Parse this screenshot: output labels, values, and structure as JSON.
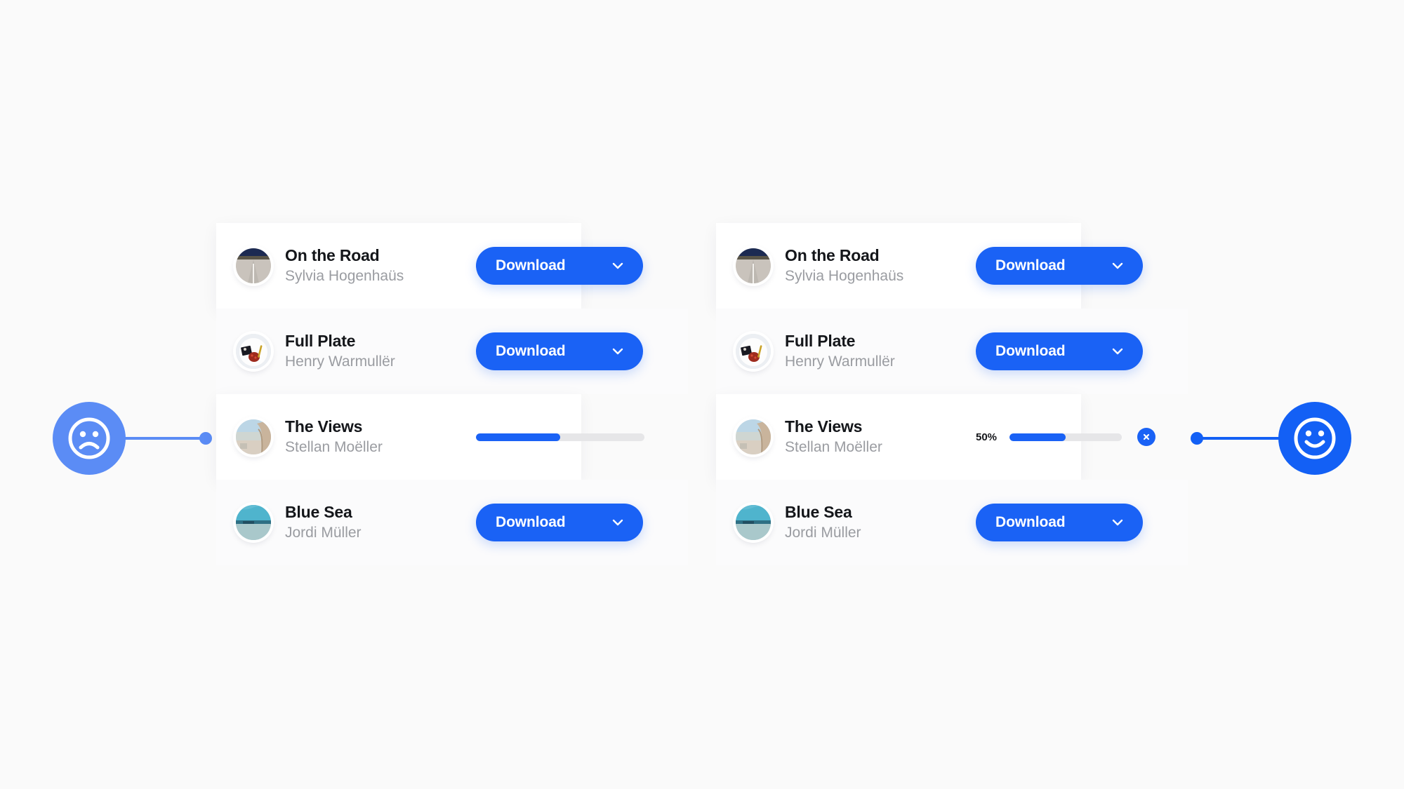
{
  "background_color": "#fafafa",
  "accent_color": "#1a62f5",
  "accent_light_color": "#5b8cf5",
  "track_color": "#e6e6e8",
  "badges": {
    "left": {
      "icon": "frowning-face-icon",
      "label": "Sad state",
      "color": "#5b8cf5"
    },
    "right": {
      "icon": "smiling-face-icon",
      "label": "Happy state",
      "color": "#1360f5"
    }
  },
  "panels": [
    {
      "id": "before",
      "rows": [
        {
          "title": "On the Road",
          "author": "Sylvia Hogenhaüs",
          "thumb": "road-photo-thumbnail",
          "action": "download",
          "button_label": "Download",
          "chevron": "chevron-down-icon"
        },
        {
          "title": "Full Plate",
          "author": "Henry Warmullër",
          "thumb": "plate-photo-thumbnail",
          "action": "download",
          "button_label": "Download",
          "chevron": "chevron-down-icon"
        },
        {
          "title": "The Views",
          "author": "Stellan Moëller",
          "thumb": "views-photo-thumbnail",
          "action": "progress",
          "progress_percent": 50,
          "progress_label": "",
          "show_percent": false,
          "show_cancel": false
        },
        {
          "title": "Blue Sea",
          "author": "Jordi Müller",
          "thumb": "sea-photo-thumbnail",
          "action": "download",
          "button_label": "Download",
          "chevron": "chevron-down-icon"
        }
      ]
    },
    {
      "id": "after",
      "rows": [
        {
          "title": "On the Road",
          "author": "Sylvia Hogenhaüs",
          "thumb": "road-photo-thumbnail",
          "action": "download",
          "button_label": "Download",
          "chevron": "chevron-down-icon"
        },
        {
          "title": "Full Plate",
          "author": "Henry Warmullër",
          "thumb": "plate-photo-thumbnail",
          "action": "download",
          "button_label": "Download",
          "chevron": "chevron-down-icon"
        },
        {
          "title": "The Views",
          "author": "Stellan Moëller",
          "thumb": "views-photo-thumbnail",
          "action": "progress",
          "progress_percent": 50,
          "progress_label": "50%",
          "show_percent": true,
          "show_cancel": true,
          "cancel_icon": "close-x-icon"
        },
        {
          "title": "Blue Sea",
          "author": "Jordi Müller",
          "thumb": "sea-photo-thumbnail",
          "action": "download",
          "button_label": "Download",
          "chevron": "chevron-down-icon"
        }
      ]
    }
  ]
}
